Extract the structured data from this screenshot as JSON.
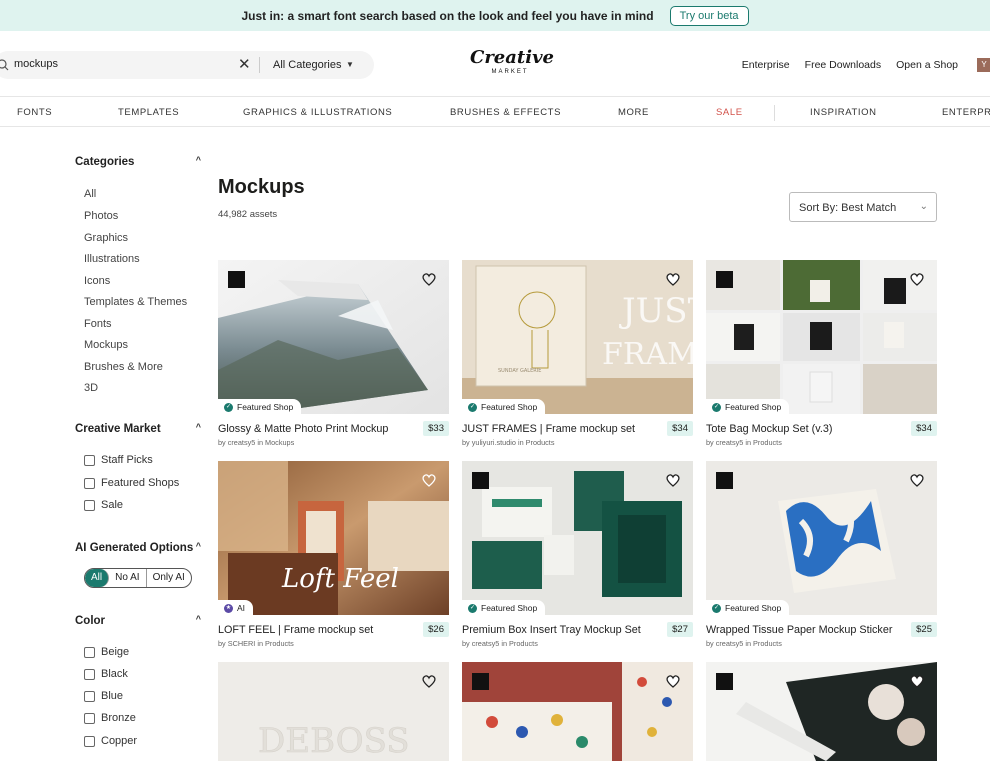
{
  "banner": {
    "text": "Just in: a smart font search based on the look and feel you have in mind",
    "button": "Try our beta"
  },
  "header": {
    "search_value": "mockups",
    "category_select": "All Categories",
    "logo_top": "Creative",
    "logo_bottom": "MARKET",
    "links": [
      "Enterprise",
      "Free Downloads",
      "Open a Shop"
    ],
    "avatar_initial": "Y"
  },
  "nav": [
    "FONTS",
    "TEMPLATES",
    "GRAPHICS & ILLUSTRATIONS",
    "BRUSHES & EFFECTS",
    "MORE",
    "SALE",
    "INSPIRATION",
    "ENTERPRISE"
  ],
  "sidebar": {
    "categories_title": "Categories",
    "categories": [
      "All",
      "Photos",
      "Graphics",
      "Illustrations",
      "Icons",
      "Templates & Themes",
      "Fonts",
      "Mockups",
      "Brushes & More",
      "3D"
    ],
    "cm_title": "Creative Market",
    "cm_options": [
      "Staff Picks",
      "Featured Shops",
      "Sale"
    ],
    "ai_title": "AI Generated Options",
    "ai_options": [
      "All",
      "No AI",
      "Only AI"
    ],
    "color_title": "Color",
    "colors": [
      "Beige",
      "Black",
      "Blue",
      "Bronze",
      "Copper"
    ]
  },
  "main": {
    "title": "Mockups",
    "count": "44,982 assets",
    "sort": "Sort By: Best Match",
    "products": [
      {
        "title": "Glossy & Matte Photo Print Mockup",
        "price": "$33",
        "byline": "by creatsy5 in Mockups",
        "badge": "Featured Shop"
      },
      {
        "title": "JUST FRAMES | Frame mockup set",
        "price": "$34",
        "byline": "by yuliyuri.studio in Products",
        "badge": "Featured Shop"
      },
      {
        "title": "Tote Bag Mockup Set (v.3)",
        "price": "$34",
        "byline": "by creatsy5 in Products",
        "badge": "Featured Shop"
      },
      {
        "title": "LOFT FEEL | Frame mockup set",
        "price": "$26",
        "byline": "by SCHERI in Products",
        "badge": "AI"
      },
      {
        "title": "Premium Box Insert Tray Mockup Set",
        "price": "$27",
        "byline": "by creatsy5 in Products",
        "badge": "Featured Shop"
      },
      {
        "title": "Wrapped Tissue Paper Mockup Sticker",
        "price": "$25",
        "byline": "by creatsy5 in Products",
        "badge": "Featured Shop"
      }
    ],
    "image_text": {
      "just_frames_1": "JUST",
      "just_frames_2": "FRAMES",
      "sunday": "SUNDAY GALERIE",
      "loft": "Loft Feel",
      "deboss": "DEBOSS"
    }
  },
  "colors": {
    "accent": "#1b7a6e",
    "sale": "#d2524a",
    "banner_bg": "#dff3ef"
  }
}
